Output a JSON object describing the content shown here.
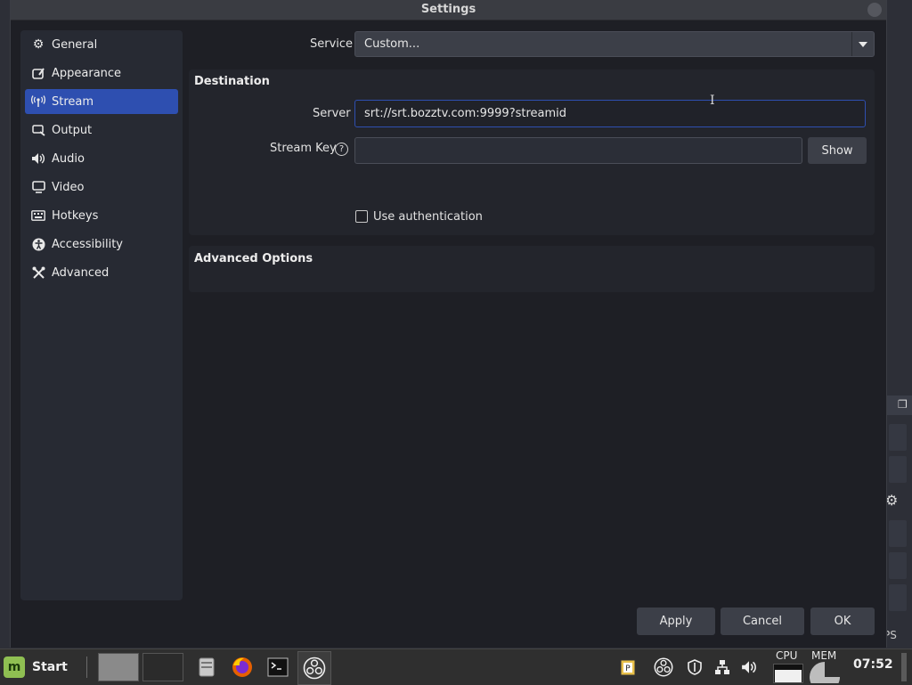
{
  "window": {
    "title": "Settings"
  },
  "sidebar": {
    "items": [
      {
        "label": "General",
        "icon": "gear-icon",
        "active": false
      },
      {
        "label": "Appearance",
        "icon": "appearance-icon",
        "active": false
      },
      {
        "label": "Stream",
        "icon": "stream-antenna-icon",
        "active": true
      },
      {
        "label": "Output",
        "icon": "output-icon",
        "active": false
      },
      {
        "label": "Audio",
        "icon": "speaker-icon",
        "active": false
      },
      {
        "label": "Video",
        "icon": "monitor-icon",
        "active": false
      },
      {
        "label": "Hotkeys",
        "icon": "keyboard-icon",
        "active": false
      },
      {
        "label": "Accessibility",
        "icon": "accessibility-icon",
        "active": false
      },
      {
        "label": "Advanced",
        "icon": "tools-icon",
        "active": false
      }
    ]
  },
  "service": {
    "label": "Service",
    "value": "Custom..."
  },
  "destination": {
    "title": "Destination",
    "server_label": "Server",
    "server_value": "srt://srt.bozztv.com:9999?streamid",
    "stream_key_label": "Stream Key",
    "stream_key_value": "",
    "show_button": "Show",
    "use_auth_label": "Use authentication",
    "use_auth_checked": false
  },
  "advanced_options": {
    "title": "Advanced Options"
  },
  "footer": {
    "apply": "Apply",
    "cancel": "Cancel",
    "ok": "OK"
  },
  "background": {
    "fps_fragment": "PS"
  },
  "taskbar": {
    "start_label": "Start",
    "start_icon": "linux-mint-logo",
    "cpu_label": "CPU",
    "mem_label": "MEM",
    "clock": "07:52"
  },
  "colors": {
    "accent": "#2e4fb0",
    "dialog_bg": "#1e1f25",
    "panel_bg": "#272a33",
    "input_bg": "#3c3f48"
  }
}
